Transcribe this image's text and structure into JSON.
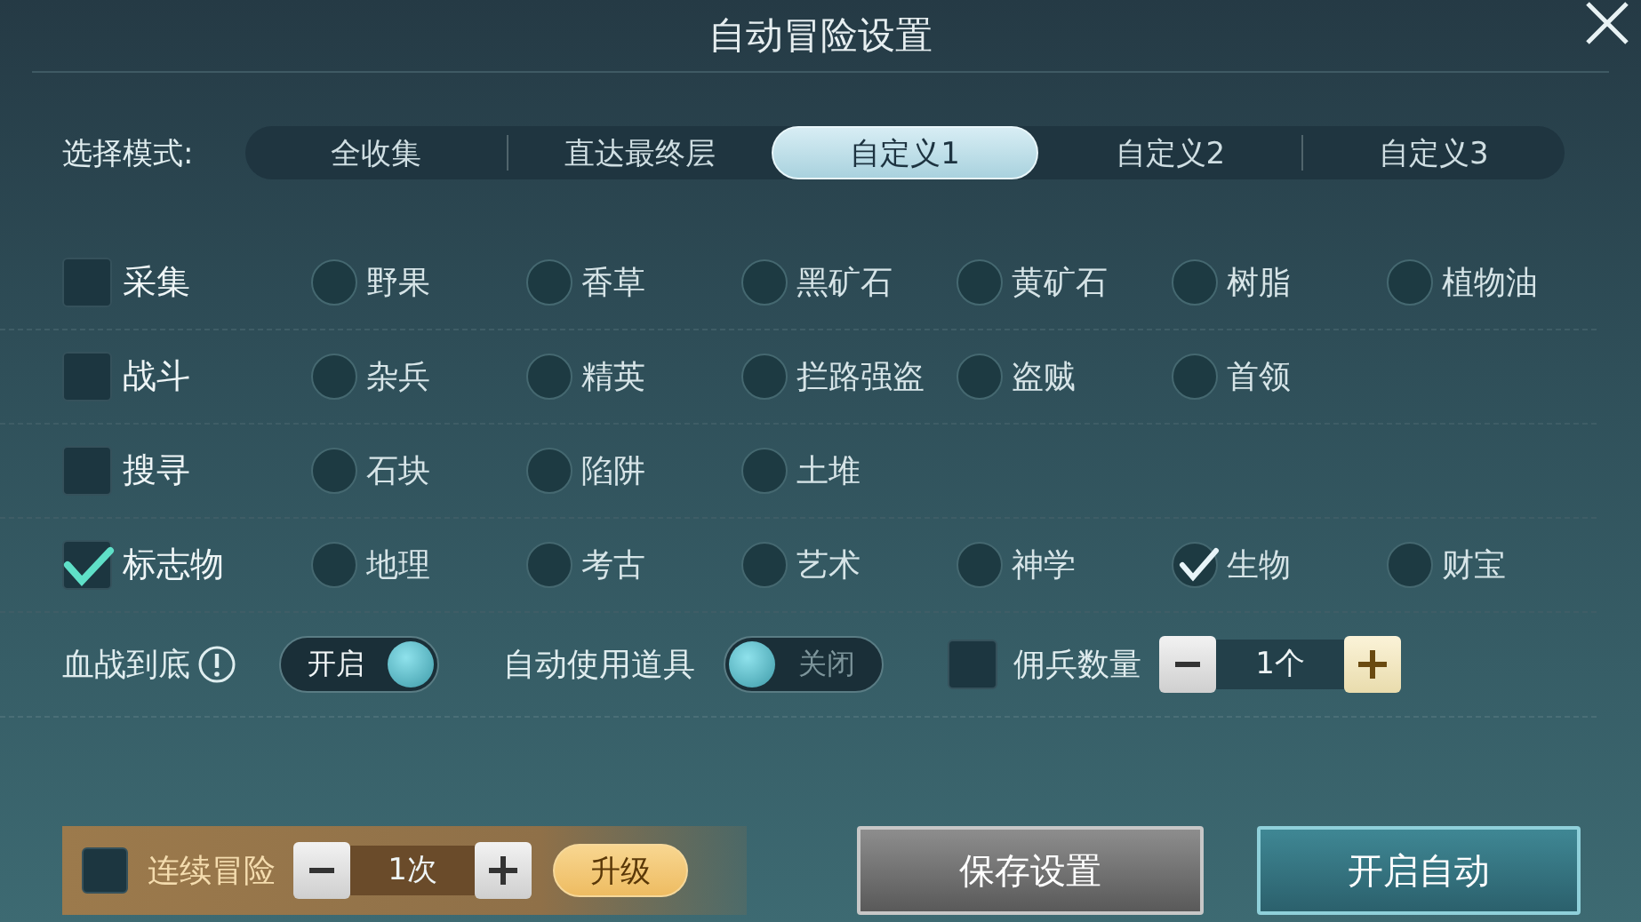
{
  "title": "自动冒险设置",
  "mode": {
    "label": "选择模式:",
    "tabs": [
      {
        "label": "全收集",
        "selected": false
      },
      {
        "label": "直达最终层",
        "selected": false
      },
      {
        "label": "自定义1",
        "selected": true
      },
      {
        "label": "自定义2",
        "selected": false
      },
      {
        "label": "自定义3",
        "selected": false
      }
    ]
  },
  "categories": [
    {
      "label": "采集",
      "checked": false,
      "options": [
        {
          "label": "野果",
          "checked": false
        },
        {
          "label": "香草",
          "checked": false
        },
        {
          "label": "黑矿石",
          "checked": false
        },
        {
          "label": "黄矿石",
          "checked": false
        },
        {
          "label": "树脂",
          "checked": false
        },
        {
          "label": "植物油",
          "checked": false
        }
      ]
    },
    {
      "label": "战斗",
      "checked": false,
      "options": [
        {
          "label": "杂兵",
          "checked": false
        },
        {
          "label": "精英",
          "checked": false
        },
        {
          "label": "拦路强盗",
          "checked": false
        },
        {
          "label": "盗贼",
          "checked": false
        },
        {
          "label": "首领",
          "checked": false
        }
      ]
    },
    {
      "label": "搜寻",
      "checked": false,
      "options": [
        {
          "label": "石块",
          "checked": false
        },
        {
          "label": "陷阱",
          "checked": false
        },
        {
          "label": "土堆",
          "checked": false
        }
      ]
    },
    {
      "label": "标志物",
      "checked": true,
      "options": [
        {
          "label": "地理",
          "checked": false
        },
        {
          "label": "考古",
          "checked": false
        },
        {
          "label": "艺术",
          "checked": false
        },
        {
          "label": "神学",
          "checked": false
        },
        {
          "label": "生物",
          "checked": true
        },
        {
          "label": "财宝",
          "checked": false
        }
      ]
    }
  ],
  "settings": [
    {
      "kind": "toggle",
      "label": "血战到底",
      "info_icon": true,
      "on": true,
      "state_text": "开启"
    },
    {
      "kind": "toggle",
      "label": "自动使用道具",
      "info_icon": false,
      "on": false,
      "state_text": "关闭"
    },
    {
      "kind": "counter",
      "label": "佣兵数量",
      "checked": false,
      "value": "1个"
    }
  ],
  "continuous": {
    "label": "连续冒险",
    "checked": false,
    "value": "1次",
    "upgrade": "升级"
  },
  "buttons": [
    {
      "label": "保存设置",
      "kind": "secondary"
    },
    {
      "label": "开启自动",
      "kind": "primary"
    }
  ]
}
